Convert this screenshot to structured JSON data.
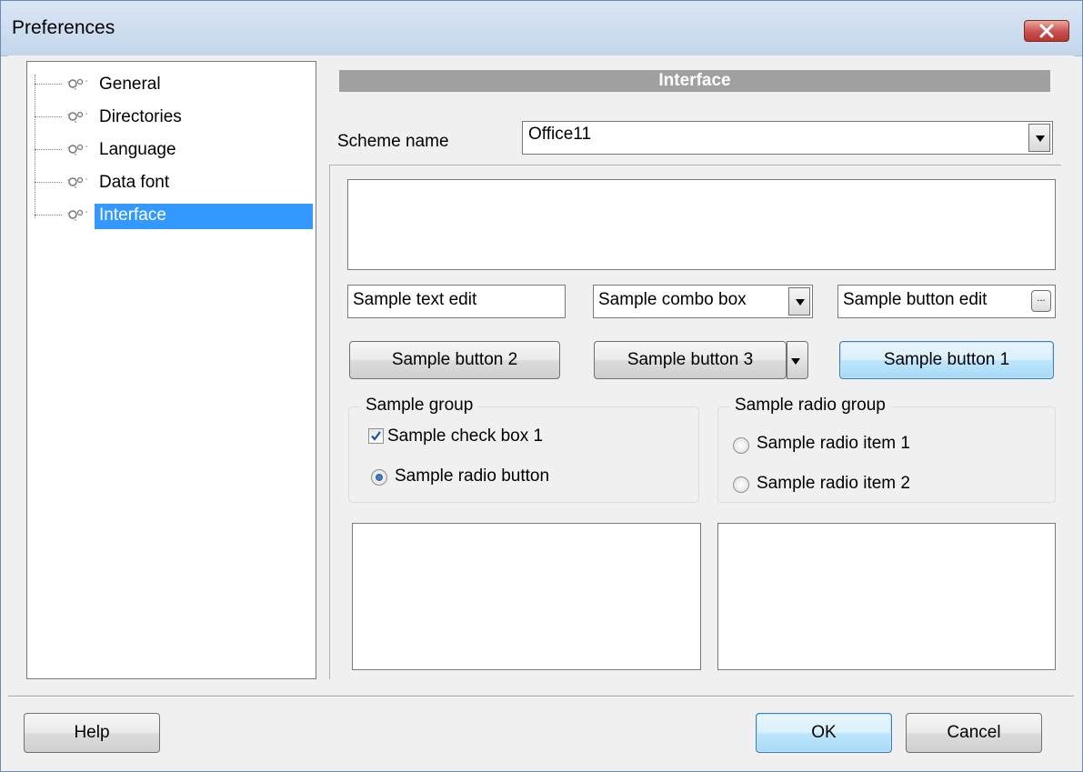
{
  "window": {
    "title": "Preferences",
    "close_icon": "close-icon"
  },
  "tree": {
    "items": [
      {
        "label": "General",
        "icon": "tree-node-icon"
      },
      {
        "label": "Directories",
        "icon": "tree-node-icon"
      },
      {
        "label": "Language",
        "icon": "tree-node-icon"
      },
      {
        "label": "Data font",
        "icon": "tree-node-icon"
      },
      {
        "label": "Interface",
        "icon": "tree-node-icon",
        "selected": true
      }
    ]
  },
  "panel": {
    "header": "Interface",
    "scheme_label": "Scheme name",
    "scheme_value": "Office11"
  },
  "samples": {
    "text_edit": "Sample text edit",
    "combo_box": "Sample combo box",
    "button_edit": "Sample button edit",
    "button_edit_ellipsis": "...",
    "button2": "Sample button 2",
    "button3": "Sample button 3",
    "button1": "Sample button 1",
    "group_title": "Sample group",
    "check_box": "Sample check box 1",
    "check_box_checked": true,
    "radio_button": "Sample radio button",
    "radio_group_title": "Sample radio group",
    "radio_item1": "Sample radio item 1",
    "radio_item2": "Sample radio item 2"
  },
  "footer": {
    "help": "Help",
    "ok": "OK",
    "cancel": "Cancel"
  },
  "colors": {
    "selection": "#3399ff",
    "header_bar": "#a0a0a0",
    "close_button": "#c75050"
  }
}
